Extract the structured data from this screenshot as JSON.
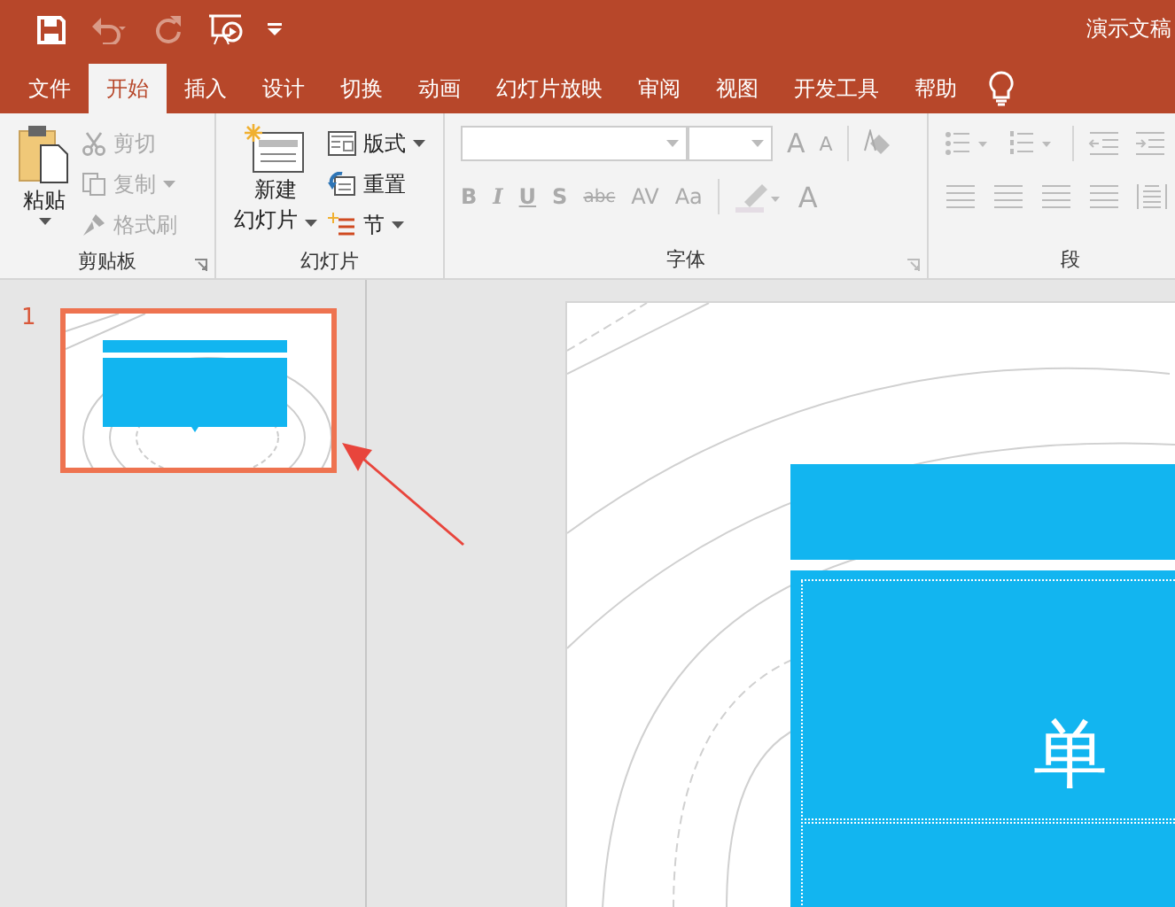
{
  "window": {
    "title": "演示文稿"
  },
  "quick_access": [
    {
      "kind": "save",
      "disabled": false
    },
    {
      "kind": "undo",
      "disabled": true
    },
    {
      "kind": "redo",
      "disabled": true
    },
    {
      "kind": "present",
      "disabled": false
    },
    {
      "kind": "customize",
      "disabled": false
    }
  ],
  "tabs": [
    {
      "label": "文件",
      "selected": false
    },
    {
      "label": "开始",
      "selected": true
    },
    {
      "label": "插入",
      "selected": false
    },
    {
      "label": "设计",
      "selected": false
    },
    {
      "label": "切换",
      "selected": false
    },
    {
      "label": "动画",
      "selected": false
    },
    {
      "label": "幻灯片放映",
      "selected": false
    },
    {
      "label": "审阅",
      "selected": false
    },
    {
      "label": "视图",
      "selected": false
    },
    {
      "label": "开发工具",
      "selected": false
    },
    {
      "label": "帮助",
      "selected": false
    }
  ],
  "clipboard": {
    "label": "剪贴板",
    "paste": {
      "label": "粘贴"
    },
    "items": [
      {
        "kind": "cut",
        "label": "剪切",
        "disabled": true
      },
      {
        "kind": "copy",
        "label": "复制",
        "disabled": true
      },
      {
        "kind": "format-painter",
        "label": "格式刷",
        "disabled": true
      }
    ]
  },
  "slides_group": {
    "label": "幻灯片",
    "new_slide": {
      "lines": [
        "新建",
        "幻灯片"
      ]
    },
    "items": [
      {
        "kind": "layout",
        "label": "版式"
      },
      {
        "kind": "reset",
        "label": "重置"
      },
      {
        "kind": "section",
        "label": "节"
      }
    ]
  },
  "font": {
    "label": "字体",
    "row1": [
      {
        "label": "A",
        "kind": "grow"
      },
      {
        "label": "A",
        "kind": "shrink"
      }
    ],
    "row2": [
      {
        "label": "B",
        "kind": "bold"
      },
      {
        "label": "I",
        "kind": "italic"
      },
      {
        "label": "U",
        "kind": "underline"
      },
      {
        "label": "S",
        "kind": "shadow"
      },
      {
        "label": "abc",
        "kind": "strike"
      },
      {
        "label": "AV",
        "kind": "spacing"
      },
      {
        "label": "Aa",
        "kind": "case"
      }
    ],
    "color_label": "A"
  },
  "paragraph": {
    "label": "段"
  },
  "slide_panel": {
    "slides": [
      {
        "number": "1",
        "selected": true
      }
    ]
  },
  "slide": {
    "title_text": "单"
  }
}
